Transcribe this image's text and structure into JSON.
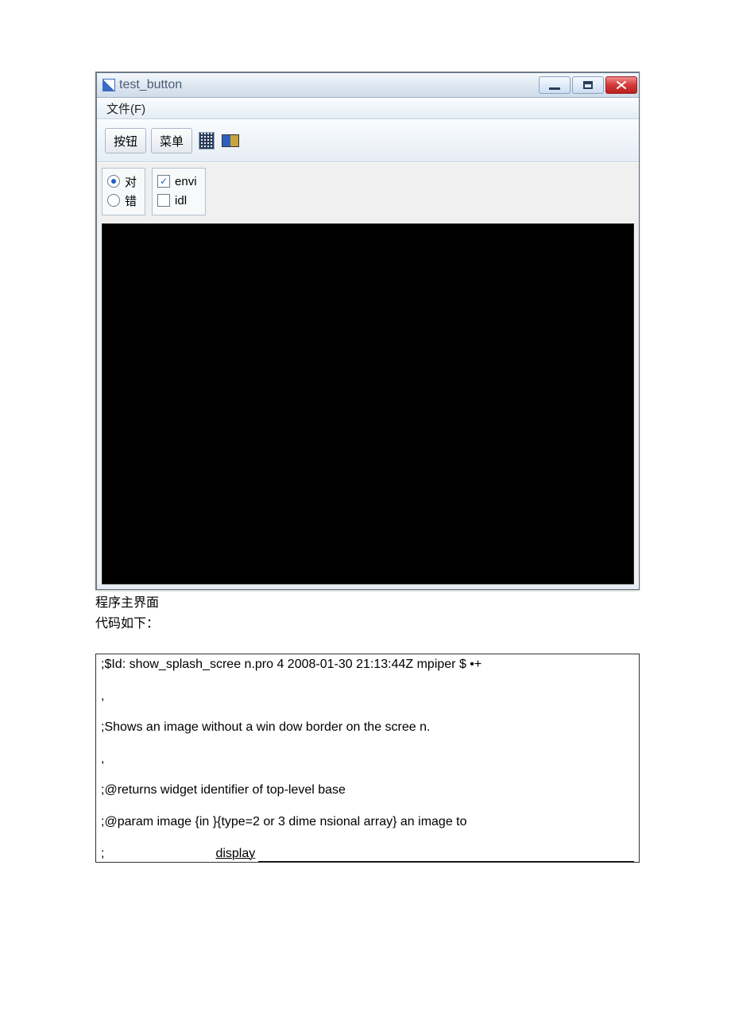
{
  "window": {
    "title": "test_button",
    "menubar": {
      "file": "文件(F)"
    },
    "toolbar": {
      "button_label": "按钮",
      "menu_label": "菜单"
    },
    "options_radio": {
      "true_label": "对",
      "false_label": "错",
      "selected": "true"
    },
    "options_check": {
      "envi_label": "envi",
      "idl_label": "idl",
      "envi_checked": true,
      "idl_checked": false
    }
  },
  "page": {
    "caption_main": "程序主界面",
    "caption_code": "代码如下：",
    "code_lines": {
      "l1": ";$Id: show_splash_scree n.pro 4 2008-01-30 21:13:44Z mpiper $ •+",
      "l2": ",",
      "l3": ";Shows an image without a win dow border on the scree n.",
      "l4": ",",
      "l5": ";@returns widget identifier of top-level base",
      "l6": ";@param image {in }{type=2 or 3 dime nsional array} an image to",
      "l7_prefix": ";",
      "l7_word": "display"
    }
  }
}
